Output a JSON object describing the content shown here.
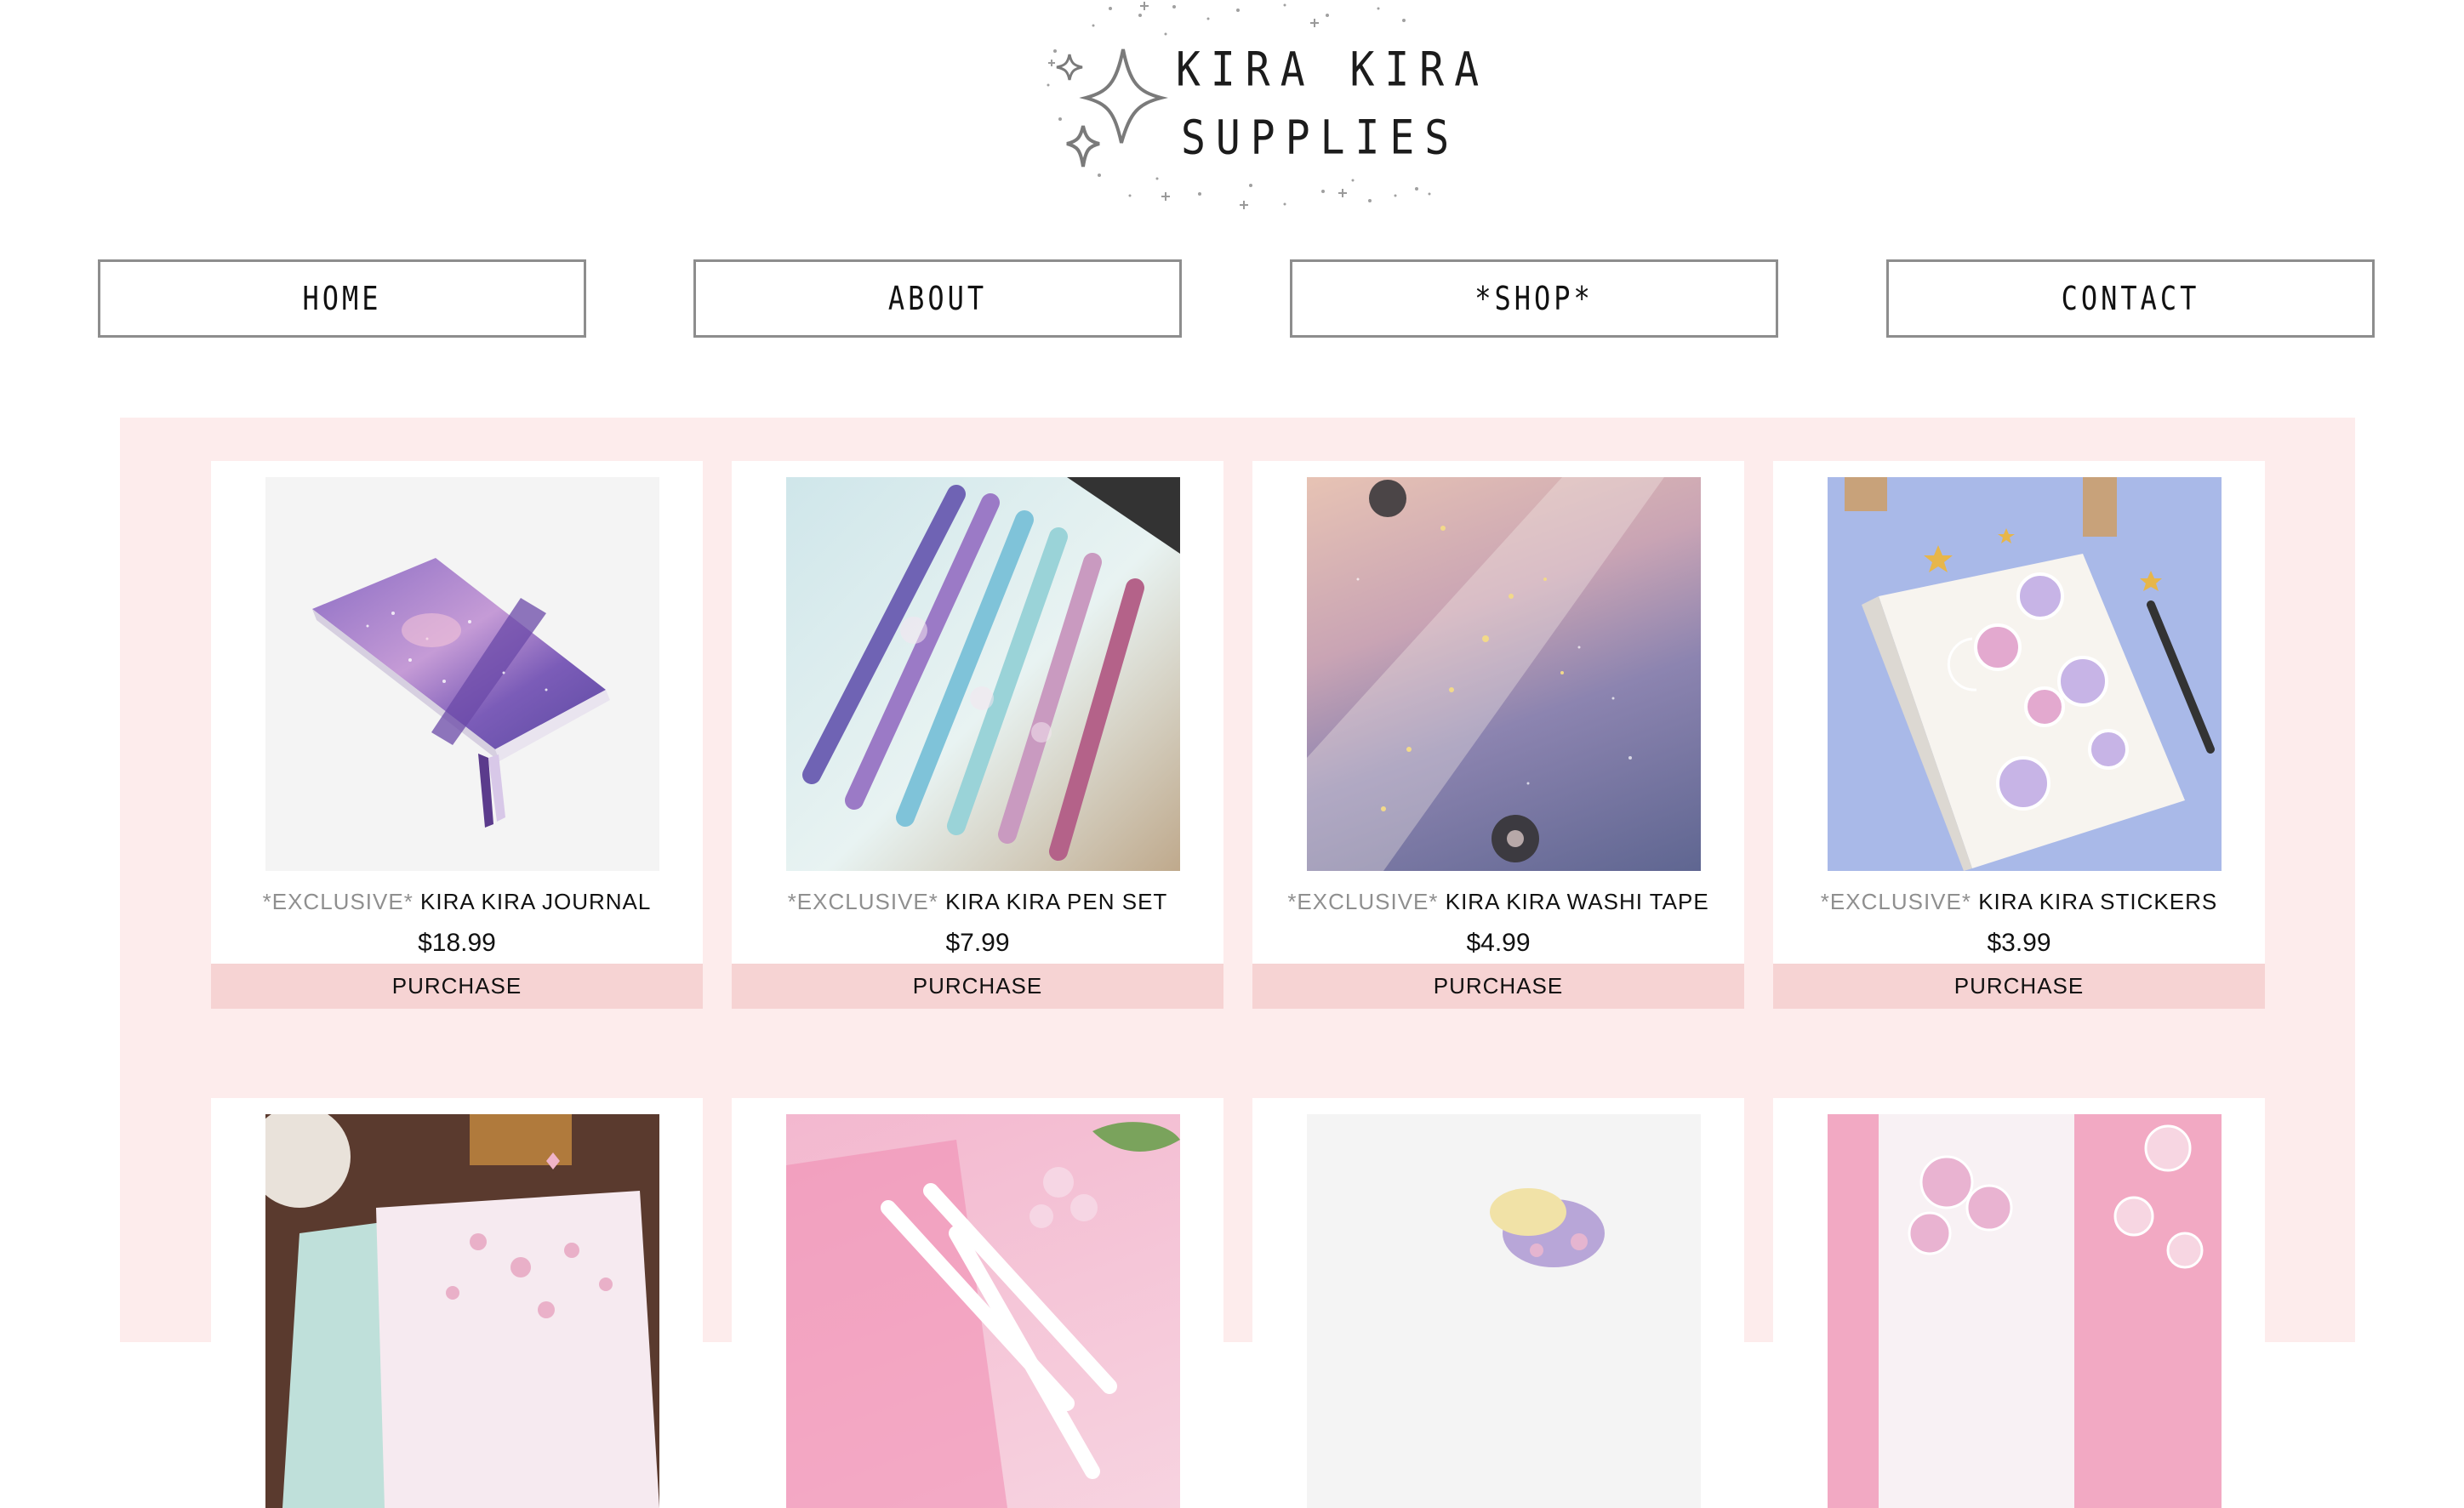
{
  "site": {
    "logo_line1": "KIRA KIRA",
    "logo_line2": "SUPPLIES",
    "logo_icon": "sparkle-stars-icon"
  },
  "nav": {
    "items": [
      {
        "label": "HOME"
      },
      {
        "label": "ABOUT"
      },
      {
        "label": "*SHOP*"
      },
      {
        "label": "CONTACT"
      }
    ]
  },
  "colors": {
    "shop_background": "#fdecec",
    "purchase_button": "#f6d3d3",
    "exclusive_text": "#8f8f8f"
  },
  "products": [
    {
      "tag": "*EXCLUSIVE*",
      "name": "KIRA KIRA JOURNAL",
      "price": "$18.99",
      "button": "PURCHASE",
      "image": "purple-galaxy-journal"
    },
    {
      "tag": "*EXCLUSIVE*",
      "name": "KIRA KIRA PEN SET",
      "price": "$7.99",
      "button": "PURCHASE",
      "image": "galaxy-gel-pens"
    },
    {
      "tag": "*EXCLUSIVE*",
      "name": "KIRA KIRA WASHI TAPE",
      "price": "$4.99",
      "button": "PURCHASE",
      "image": "galaxy-washi-tape"
    },
    {
      "tag": "*EXCLUSIVE*",
      "name": "KIRA KIRA STICKERS",
      "price": "$3.99",
      "button": "PURCHASE",
      "image": "planet-stickers-notebook"
    }
  ],
  "products_row2": [
    {
      "image": "cherry-blossom-notebooks"
    },
    {
      "image": "pink-pens-sakura"
    },
    {
      "image": "floral-washi-tape"
    },
    {
      "image": "sakura-stickers"
    }
  ]
}
